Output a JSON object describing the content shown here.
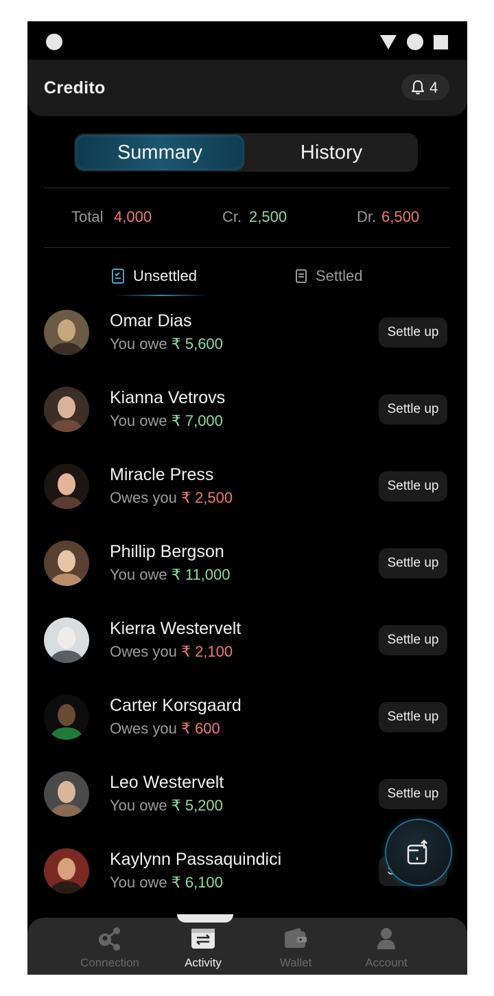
{
  "app": {
    "title": "Credito",
    "notification_count": "4"
  },
  "segment": {
    "tabs": [
      "Summary",
      "History"
    ],
    "active": "Summary"
  },
  "totals": {
    "total_label": "Total",
    "total_value": "4,000",
    "credit_label": "Cr.",
    "credit_value": "2,500",
    "debit_label": "Dr.",
    "debit_value": "6,500"
  },
  "subtabs": {
    "unsettled": "Unsettled",
    "settled": "Settled",
    "active": "Unsettled"
  },
  "contacts": [
    {
      "name": "Omar Dias",
      "status": "You owe",
      "amount": "₹ 5,600",
      "direction": "owe",
      "action": "Settle up"
    },
    {
      "name": "Kianna Vetrovs",
      "status": "You owe",
      "amount": "₹ 7,000",
      "direction": "owe",
      "action": "Settle up"
    },
    {
      "name": "Miracle Press",
      "status": "Owes you",
      "amount": "₹ 2,500",
      "direction": "owed",
      "action": "Settle up"
    },
    {
      "name": "Phillip Bergson",
      "status": "You owe",
      "amount": "₹ 11,000",
      "direction": "owe",
      "action": "Settle up"
    },
    {
      "name": "Kierra Westervelt",
      "status": "Owes you",
      "amount": "₹ 2,100",
      "direction": "owed",
      "action": "Settle up"
    },
    {
      "name": "Carter Korsgaard",
      "status": "Owes you",
      "amount": "₹ 600",
      "direction": "owed",
      "action": "Settle up"
    },
    {
      "name": "Leo Westervelt",
      "status": "You owe",
      "amount": "₹ 5,200",
      "direction": "owe",
      "action": "Settle up"
    },
    {
      "name": "Kaylynn Passaquindici",
      "status": "You owe",
      "amount": "₹ 6,100",
      "direction": "owe",
      "action": "Settle up"
    }
  ],
  "nav": [
    {
      "label": "Connection",
      "icon": "share-icon",
      "active": false
    },
    {
      "label": "Activity",
      "icon": "transfer-icon",
      "active": true
    },
    {
      "label": "Wallet",
      "icon": "wallet-icon",
      "active": false
    },
    {
      "label": "Account",
      "icon": "user-icon",
      "active": false
    }
  ],
  "colors": {
    "accent": "#1b5670",
    "positive": "#8fdca0",
    "negative": "#f07878"
  }
}
